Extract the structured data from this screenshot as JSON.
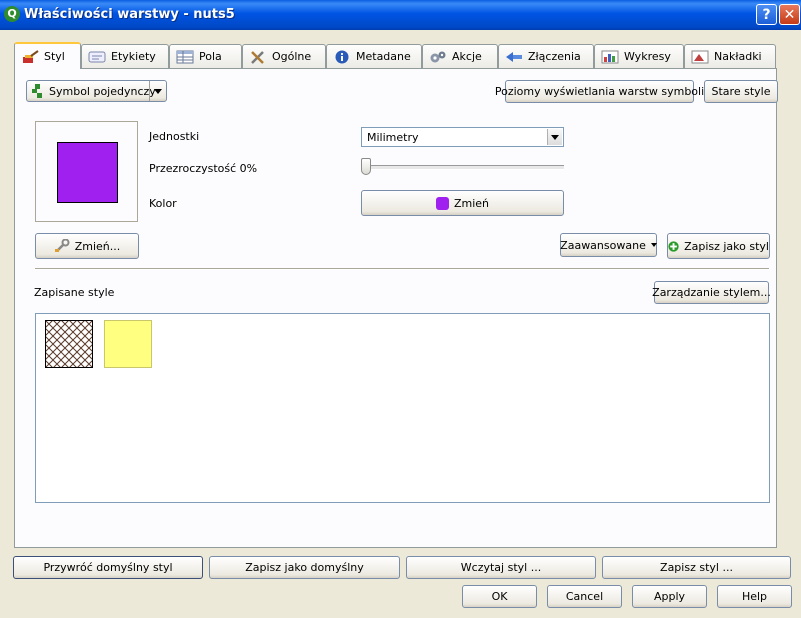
{
  "window": {
    "title": "Właściwości warstwy - nuts5",
    "help_glyph": "?",
    "close_glyph": "✕",
    "app_glyph": "Q"
  },
  "tabs": [
    {
      "label": "Styl",
      "icon": "brush-icon",
      "active": true
    },
    {
      "label": "Etykiety",
      "icon": "label-icon"
    },
    {
      "label": "Pola",
      "icon": "table-icon"
    },
    {
      "label": "Ogólne",
      "icon": "tools-icon"
    },
    {
      "label": "Metadane",
      "icon": "info-icon"
    },
    {
      "label": "Akcje",
      "icon": "gears-icon"
    },
    {
      "label": "Złączenia",
      "icon": "join-icon"
    },
    {
      "label": "Wykresy",
      "icon": "chart-icon"
    },
    {
      "label": "Nakładki",
      "icon": "overlay-icon"
    }
  ],
  "style": {
    "renderer": "Symbol pojedynczy",
    "levels_button": "Poziomy wyświetlania warstw symboli",
    "old_style_button": "Stare style",
    "symbol_color": "#a020f0",
    "units_label": "Jednostki",
    "units_value": "Milimetry",
    "transparency_label": "Przezroczystość 0%",
    "transparency_value": 0,
    "color_label": "Kolor",
    "color_button": "Zmień",
    "change_button": "Zmień...",
    "advanced_button": "Zaawansowane",
    "save_as_style_button": "Zapisz jako styl",
    "saved_styles_label": "Zapisane style",
    "manage_styles_button": "Zarządzanie stylem...",
    "saved_styles": [
      {
        "kind": "hatch",
        "fill": "#ffffff",
        "stroke": "#5a3a2a"
      },
      {
        "kind": "solid",
        "fill": "#ffff80",
        "stroke": "#c8c86a"
      }
    ]
  },
  "bottom_buttons": {
    "restore_default": "Przywróć domyślny styl",
    "save_default": "Zapisz jako domyślny",
    "load_style": "Wczytaj styl ...",
    "save_style": "Zapisz styl ..."
  },
  "dialog_buttons": {
    "ok": "OK",
    "cancel": "Cancel",
    "apply": "Apply",
    "help": "Help"
  }
}
